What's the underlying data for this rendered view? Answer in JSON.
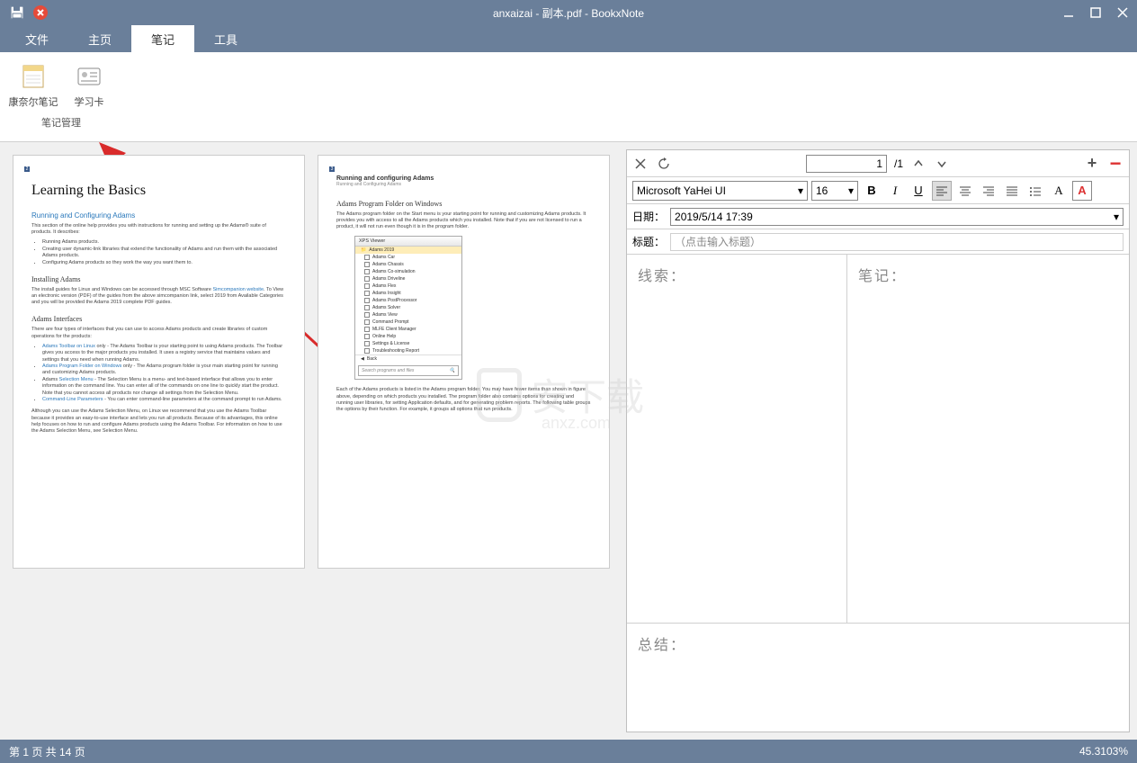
{
  "titlebar": {
    "title": "anxaizai - 副本.pdf - BookxNote"
  },
  "menu": {
    "file": "文件",
    "home": "主页",
    "notes": "笔记",
    "tools": "工具"
  },
  "ribbon": {
    "cornell": "康奈尔笔记",
    "studycard": "学习卡",
    "group": "笔记管理"
  },
  "notes_panel": {
    "page_current": "1",
    "page_total": "/1",
    "font_name": "Microsoft YaHei UI",
    "font_size": "16",
    "date_label": "日期：",
    "date_value": "2019/5/14 17:39",
    "title_label": "标题：",
    "title_placeholder": "（点击输入标题）",
    "col_clue": "线索：",
    "col_note": "笔记：",
    "summary": "总结："
  },
  "doc": {
    "page1": {
      "h1": "Learning the Basics",
      "h2a": "Running and Configuring Adams",
      "p1": "This section of the online help provides you with instructions for running and setting up the Adams® suite of products. It describes:",
      "li1": "Running Adams products.",
      "li2": "Creating user dynamic-link libraries that extend the functionality of Adams and run them with the associated Adams products.",
      "li3": "Configuring Adams products so they work the way you want them to.",
      "h3a": "Installing Adams",
      "p2a": "The install guides for Linux and Windows can be accessed through MSC Software ",
      "p2link": "Simcompanion website",
      "p2b": ". To View an electronic version (PDF) of the guides from the above simcompanion link, select 2019 from Available Categories and you will be provided the Adams 2019 complete PDF guides.",
      "h3b": "Adams Interfaces",
      "p3": "There are four types of interfaces that you can use to access Adams products and create libraries of custom operations for the products:",
      "li4a": "Adams Toolbar on Linux",
      "li4b": " only - The Adams Toolbar is your starting point to using Adams products. The Toolbar gives you access to the major products you installed. It uses a registry service that maintains values and settings that you need when running Adams.",
      "li5a": "Adams Program Folder on Windows",
      "li5b": " only - The Adams program folder is your main starting point for running and customizing Adams products.",
      "li6a": "Selection Menu",
      "li6pre": "Adams ",
      "li6b": " - The Selection Menu is a menu- and text-based interface that allows you to enter information on the command line. You can enter all of the commands on one line to quickly start the product. Note that you cannot access all products nor change all settings from the Selection Menu.",
      "li7a": "Command-Line Parameters",
      "li7b": " - You can enter command-line parameters at the command prompt to run Adams.",
      "p4": "Although you can use the Adams Selection Menu, on Linux we recommend that you use the Adams Toolbar because it provides an easy-to-use interface and lets you run all products. Because of its advantages, this online help focuses on how to run and configure Adams products using the Adams Toolbar. For information on how to use the Adams Selection Menu, see Selection Menu."
    },
    "page2": {
      "hdr": "Running and configuring Adams",
      "sub": "Running and Configuring Adams",
      "h3": "Adams Program Folder on Windows",
      "p1": "The Adams program folder on the Start menu is your starting point for running and customizing Adams products. It provides you with access to all the Adams products which you installed. Note that if you are not licensed to run a product, it will not run even though it is in the program folder.",
      "win_title": "XPS Viewer",
      "folder": "Adams 2019",
      "items": [
        "Adams Car",
        "Adams Chassis",
        "Adams Co-simulation",
        "Adams Driveline",
        "Adams Flex",
        "Adams Insight",
        "Adams PostProcessor",
        "Adams Solver",
        "Adams View",
        "Command Prompt",
        "MLFE Client Manager",
        "Online Help",
        "Settings & License",
        "Troubleshooting Report"
      ],
      "back": "Back",
      "search": "Search programs and files",
      "p2": "Each of the Adams products is listed in the Adams program folder. You may have fewer items than shown in figure above, depending on which products you installed. The program folder also contains options for creating and running user libraries, for setting Application defaults, and for generating problem reports. The following table groups the options by their function. For example, it groups all options that run products."
    }
  },
  "status": {
    "page": "第 1 页 共 14 页",
    "zoom": "45.3103%"
  },
  "watermark": {
    "text": "安下载",
    "domain": "anxz.com"
  }
}
